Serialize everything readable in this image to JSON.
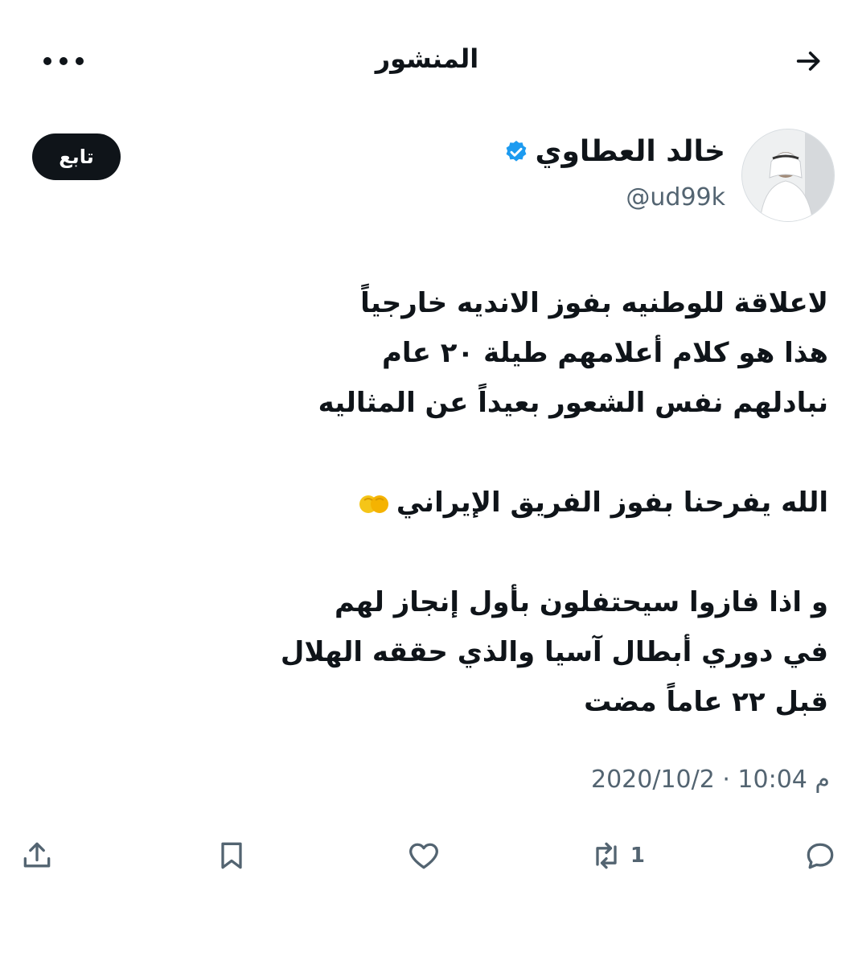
{
  "header": {
    "title": "المنشور",
    "back_icon": "arrow-right-icon",
    "more_icon": "more-horizontal-icon"
  },
  "author": {
    "name": "خالد العطاوي",
    "handle": "@ud99k",
    "verified": true,
    "follow_label": "تابع"
  },
  "tweet": {
    "lines": [
      "لاعلاقة للوطنيه  بفوز الانديه خارجياً",
      "هذا هو كلام أعلامهم  طيلة ٢٠ عام",
      "نبادلهم نفس الشعور بعيداً عن المثاليه",
      "",
      "الله يفرحنا بفوز الفريق الإيراني",
      "",
      "و اذا فازوا سيحتفلون بأول إنجاز لهم",
      "في دوري أبطال آسيا والذي حققه الهلال",
      "قبل ٢٢ عاماً مضت"
    ],
    "emoji": "clapping-hands-icon"
  },
  "timestamp": "2020/10/2 · 10:04 م",
  "actions": {
    "reply_icon": "reply-icon",
    "retweet_icon": "retweet-icon",
    "retweet_count": "1",
    "like_icon": "heart-icon",
    "bookmark_icon": "bookmark-icon",
    "share_icon": "share-icon"
  },
  "colors": {
    "text": "#0f1419",
    "secondary": "#536471",
    "verified": "#1d9bf0",
    "follow_bg": "#0f1419"
  }
}
